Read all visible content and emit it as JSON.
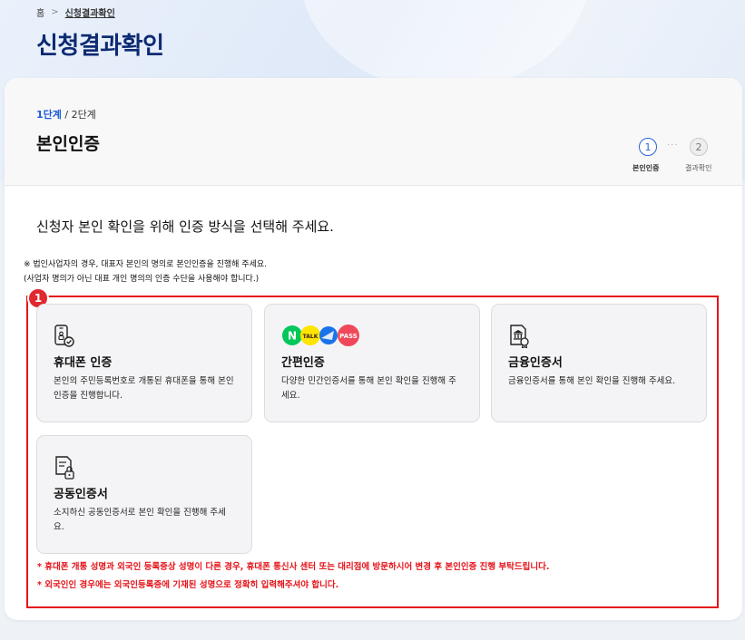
{
  "breadcrumb": {
    "home": "홈",
    "current": "신청결과확인"
  },
  "page_title": "신청결과확인",
  "card": {
    "step_current": "1단계",
    "step_separator": " / ",
    "step_total": "2단계",
    "title": "본인인증",
    "stepper": [
      {
        "number": "1",
        "label": "본인인증"
      },
      {
        "number": "2",
        "label": "결과확인"
      }
    ]
  },
  "instruction": "신청자 본인 확인을 위해 인증 방식을 선택해 주세요.",
  "notes": [
    "※ 법인사업자의 경우, 대표자 본인의 명의로 본인인증을 진행해 주세요.",
    "(사업자 명의가 아닌 대표 개인 명의의 인증 수단을 사용해야 합니다.)"
  ],
  "annotation_badge": "1",
  "options": [
    {
      "title": "휴대폰 인증",
      "desc": "본인의 주민등록번호로 개통된 휴대폰을 통해 본인 인증을 진행합니다.",
      "icon": "phone-auth-icon"
    },
    {
      "title": "간편인증",
      "desc": "다양한 민간인증서를 통해 본인 확인을 진행해 주세요.",
      "icon": "simple-auth-logos",
      "logos": [
        "N",
        "TALK",
        "PASS"
      ]
    },
    {
      "title": "금융인증서",
      "desc": "금융인증서를 통해 본인 확인을 진행해 주세요.",
      "icon": "bank-certificate-icon"
    },
    {
      "title": "공동인증서",
      "desc": "소지하신 공동인증서로 본인 확인을 진행해 주세요.",
      "icon": "joint-certificate-icon"
    }
  ],
  "warnings": [
    "* 휴대폰 개통 성명과 외국인 등록증상 성명이 다른 경우, 휴대폰 통신사 센터 또는 대리점에 방문하시어 변경 후 본인인증 진행 부탁드립니다.",
    "* 외국인인 경우에는 외국인등록증에 기재된 성명으로 정확히 입력해주셔야 합니다."
  ],
  "colors": {
    "title_navy": "#0d2a72",
    "accent_blue": "#1a5ad6",
    "warning_red": "#e5141a",
    "naver_green": "#03c75a",
    "kakao_yellow": "#fee500",
    "pass_red": "#f0485a"
  }
}
